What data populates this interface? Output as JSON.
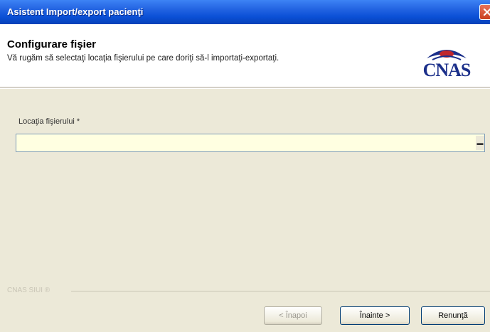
{
  "window": {
    "title": "Asistent Import/export pacienţi",
    "close_icon": "close-icon"
  },
  "header": {
    "title": "Configurare fişier",
    "subtitle": "Vă rugăm să selectaţi locaţia fişierului pe care doriţi să-l importaţi-exportaţi.",
    "logo_text": "CNAS"
  },
  "form": {
    "file_location_label": "Locaţia fişierului *",
    "file_location_value": "",
    "browse_icon": "ellipsis-icon"
  },
  "footer": {
    "label": "CNAS SIUI ®",
    "back_label": "< Înapoi",
    "next_label": "Înainte >",
    "cancel_label": "Renunţă"
  },
  "colors": {
    "titlebar": "#0a4fd6",
    "field_bg": "#ffffe1",
    "logo": "#1b2f8a"
  }
}
